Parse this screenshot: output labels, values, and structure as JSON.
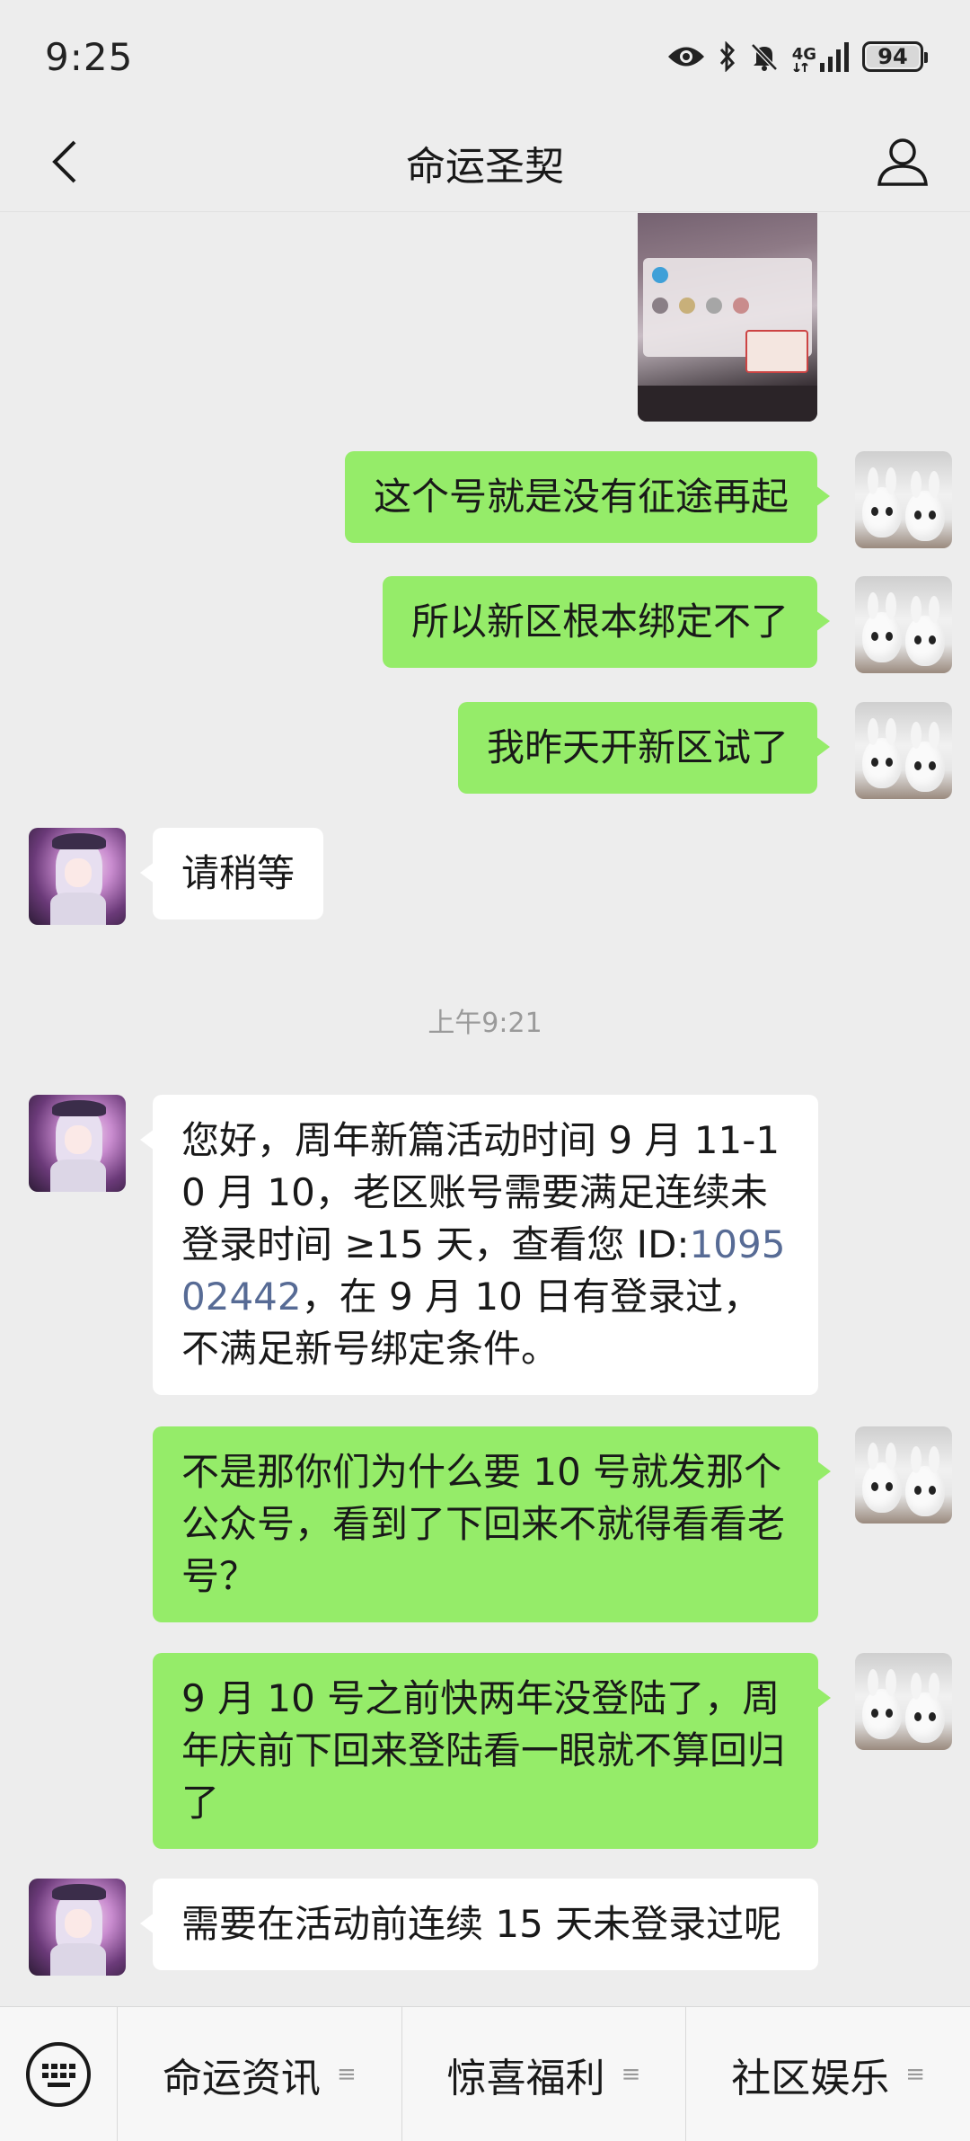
{
  "status_bar": {
    "time": "9:25",
    "network": "4G",
    "battery": "94",
    "icons": [
      "eye-icon",
      "bluetooth-icon",
      "mute-bell-icon",
      "signal-icon",
      "battery-icon"
    ]
  },
  "header": {
    "title": "命运圣契",
    "back_icon": "chevron-left-icon",
    "profile_icon": "person-icon"
  },
  "messages": [
    {
      "sender": "me",
      "type": "image"
    },
    {
      "sender": "me",
      "type": "text",
      "text": "这个号就是没有征途再起"
    },
    {
      "sender": "me",
      "type": "text",
      "text": "所以新区根本绑定不了"
    },
    {
      "sender": "me",
      "type": "text",
      "text": "我昨天开新区试了"
    },
    {
      "sender": "bot",
      "type": "text",
      "text": "请稍等"
    },
    {
      "type": "time",
      "text": "上午9:21"
    },
    {
      "sender": "bot",
      "type": "text",
      "text_before": "您好，周年新篇活动时间 9 月 11-10 月 10，老区账号需要满足连续未登录时间 ≥15 天，查看您 ID:",
      "link": "109502442",
      "text_after": "，在 9 月 10 日有登录过，不满足新号绑定条件。"
    },
    {
      "sender": "me",
      "type": "text",
      "text": "不是那你们为什么要 10 号就发那个公众号，看到了下回来不就得看看老号？"
    },
    {
      "sender": "me",
      "type": "text",
      "text": "9 月 10 号之前快两年没登陆了，周年庆前下回来登陆看一眼就不算回归了"
    },
    {
      "sender": "bot",
      "type": "text",
      "text": "需要在活动前连续 15 天未登录过呢"
    }
  ],
  "bottom_menu": {
    "keyboard_icon": "keyboard-icon",
    "items": [
      {
        "label": "命运资讯",
        "icon": "≡"
      },
      {
        "label": "惊喜福利",
        "icon": "≡"
      },
      {
        "label": "社区娱乐",
        "icon": "≡"
      }
    ]
  },
  "colors": {
    "background": "#ededed",
    "my_bubble": "#95ec69",
    "bot_bubble": "#ffffff",
    "link": "#576b95"
  }
}
